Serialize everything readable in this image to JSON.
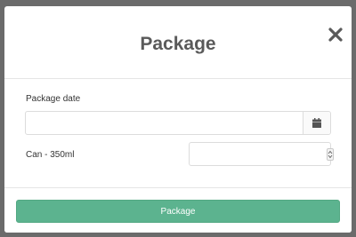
{
  "modal": {
    "title": "Package",
    "close_icon": "close-icon"
  },
  "form": {
    "date_label": "Package date",
    "date_value": "",
    "date_placeholder": "",
    "calendar_icon": "calendar-icon",
    "item_label": "Can - 350ml",
    "quantity_value": "",
    "quantity_placeholder": "",
    "spinner_icon": "spinner-arrows-icon"
  },
  "footer": {
    "submit_label": "Package"
  },
  "colors": {
    "overlay": "#6b6b6b",
    "accent": "#5cb38f",
    "title": "#5a5a5a"
  }
}
